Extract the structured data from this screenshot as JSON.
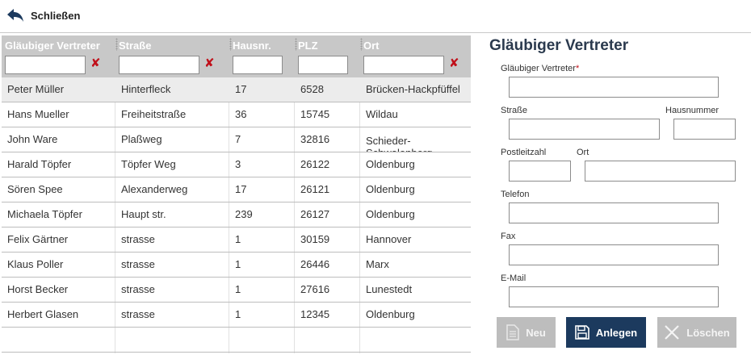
{
  "topbar": {
    "close_label": "Schließen",
    "back_icon": "back-arrow-icon"
  },
  "grid": {
    "columns": [
      {
        "label": "Gläubiger Vertreter",
        "filter_value": ""
      },
      {
        "label": "Straße",
        "filter_value": ""
      },
      {
        "label": "Hausnr.",
        "filter_value": ""
      },
      {
        "label": "PLZ",
        "filter_value": ""
      },
      {
        "label": "Ort",
        "filter_value": ""
      }
    ],
    "clear_glyph": "✘",
    "rows": [
      [
        "Peter Müller",
        "Hinterfleck",
        "17",
        "6528",
        "Brücken-Hackpfüffel"
      ],
      [
        "Hans Mueller",
        "Freiheitstraße",
        "36",
        "15745",
        "Wildau"
      ],
      [
        "John Ware",
        "Plaßweg",
        "7",
        "32816",
        "Schieder-Schwalenberg"
      ],
      [
        "Harald Töpfer",
        "Töpfer Weg",
        "3",
        "26122",
        "Oldenburg"
      ],
      [
        "Sören Spee",
        "Alexanderweg",
        "17",
        "26121",
        "Oldenburg"
      ],
      [
        "Michaela Töpfer",
        "Haupt str.",
        "239",
        "26127",
        "Oldenburg"
      ],
      [
        "Felix Gärtner",
        "strasse",
        "1",
        "30159",
        "Hannover"
      ],
      [
        "Klaus Poller",
        "strasse",
        "1",
        "26446",
        "Marx"
      ],
      [
        "Horst Becker",
        "strasse",
        "1",
        "27616",
        "Lunestedt"
      ],
      [
        "Herbert Glasen",
        "strasse",
        "1",
        "12345",
        "Oldenburg"
      ]
    ]
  },
  "form": {
    "title": "Gläubiger Vertreter",
    "fields": {
      "vertreter": {
        "label": "Gläubiger Vertreter",
        "required_mark": "*",
        "value": ""
      },
      "strasse": {
        "label": "Straße",
        "value": ""
      },
      "hausnummer": {
        "label": "Hausnummer",
        "value": ""
      },
      "postleitzahl": {
        "label": "Postleitzahl",
        "value": ""
      },
      "ort": {
        "label": "Ort",
        "value": ""
      },
      "telefon": {
        "label": "Telefon",
        "value": ""
      },
      "fax": {
        "label": "Fax",
        "value": ""
      },
      "email": {
        "label": "E-Mail",
        "value": ""
      }
    },
    "buttons": {
      "neu": "Neu",
      "anlegen": "Anlegen",
      "loeschen": "Löschen"
    }
  },
  "colors": {
    "header_bg": "#c8c8c8",
    "title": "#2b3a4e",
    "primary_button": "#1c3a5e",
    "disabled_button": "#bdbdbd",
    "clear_icon": "#c0101a",
    "selected_row": "#ececec"
  }
}
